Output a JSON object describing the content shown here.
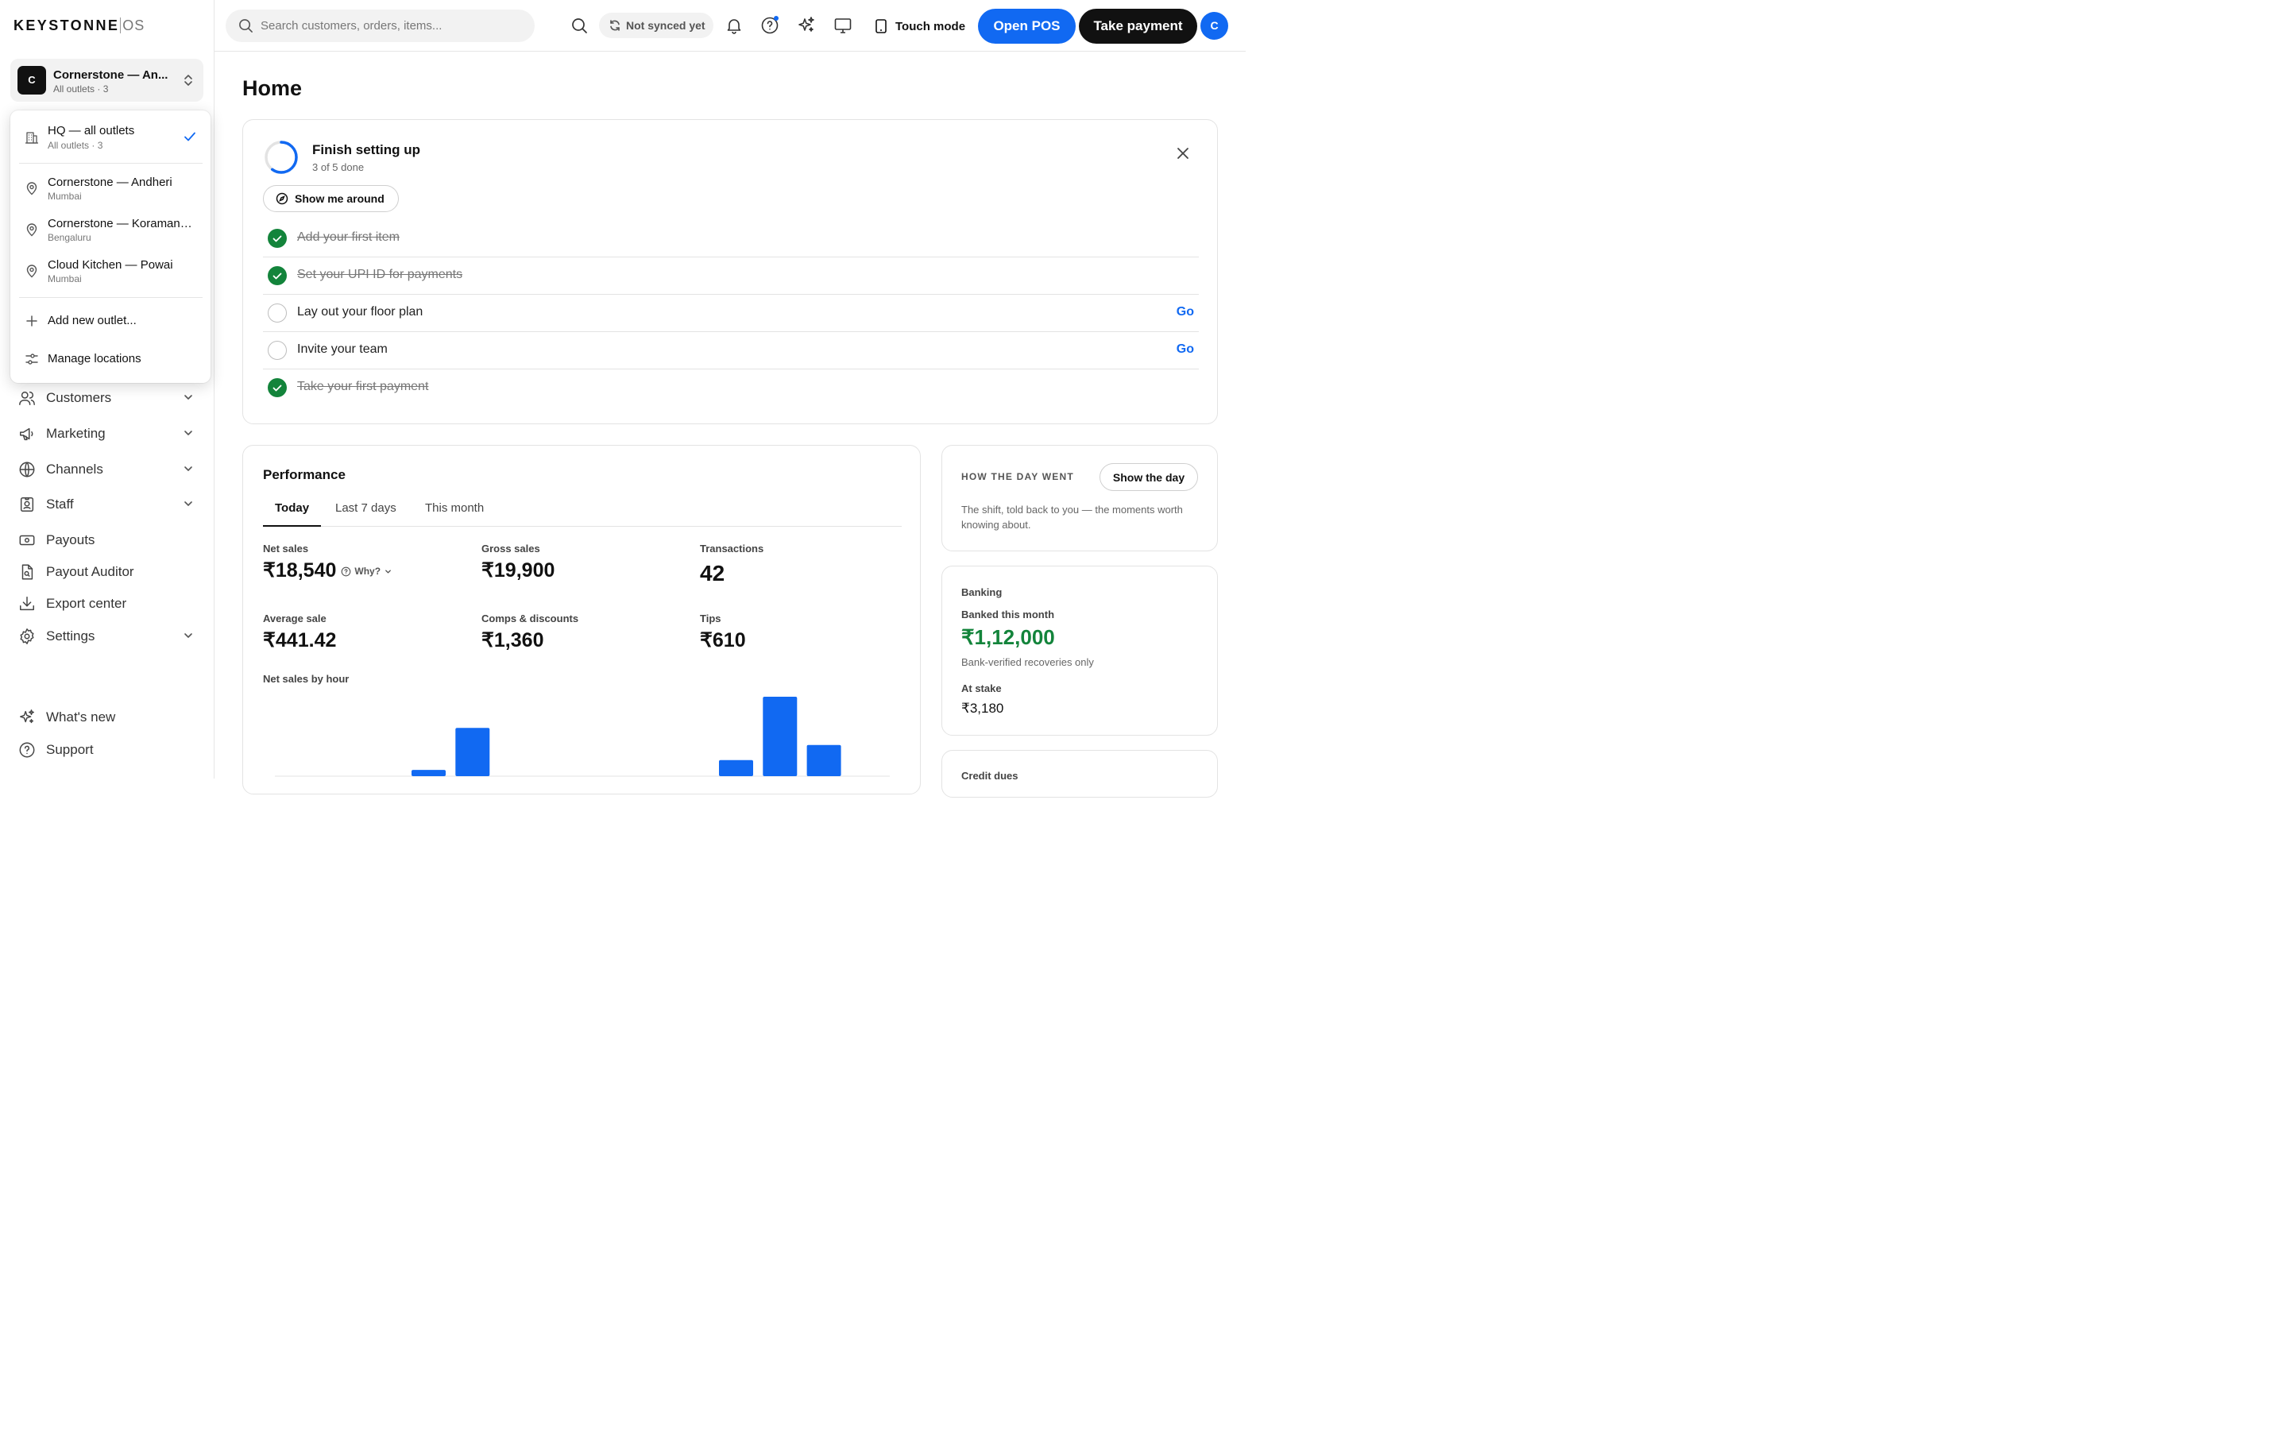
{
  "app": {
    "logo_main": "KEYSTONNE",
    "logo_suffix": "OS"
  },
  "org_switcher": {
    "avatar": "C",
    "name": "Cornerstone — An...",
    "sub": "All outlets · 3"
  },
  "outlet_menu": {
    "items": [
      {
        "title": "HQ — all outlets",
        "sub": "All outlets · 3",
        "selected": true,
        "icon": "building-icon"
      },
      {
        "title": "Cornerstone — Andheri",
        "sub": "Mumbai",
        "icon": "map-pin-icon"
      },
      {
        "title": "Cornerstone — Koramangala",
        "sub": "Bengaluru",
        "icon": "map-pin-icon"
      },
      {
        "title": "Cloud Kitchen — Powai",
        "sub": "Mumbai",
        "icon": "map-pin-icon"
      }
    ],
    "add_label": "Add new outlet...",
    "manage_label": "Manage locations"
  },
  "sidebar": {
    "items": [
      {
        "label": "Customers",
        "icon": "users-icon",
        "expandable": true
      },
      {
        "label": "Marketing",
        "icon": "megaphone-icon",
        "expandable": true
      },
      {
        "label": "Channels",
        "icon": "globe-icon",
        "expandable": true
      },
      {
        "label": "Staff",
        "icon": "id-badge-icon",
        "expandable": true
      },
      {
        "label": "Payouts",
        "icon": "banknote-icon",
        "expandable": false
      },
      {
        "label": "Payout Auditor",
        "icon": "file-search-icon",
        "expandable": false
      },
      {
        "label": "Export center",
        "icon": "download-icon",
        "expandable": false
      },
      {
        "label": "Settings",
        "icon": "gear-icon",
        "expandable": true
      }
    ],
    "footer": [
      {
        "label": "What's new",
        "icon": "sparkles-icon"
      },
      {
        "label": "Support",
        "icon": "help-circle-icon"
      }
    ]
  },
  "topbar": {
    "search_placeholder": "Search customers, orders, items...",
    "sync_status": "Not synced yet",
    "touch_mode": "Touch mode",
    "open_pos": "Open POS",
    "take_payment": "Take payment",
    "avatar": "C"
  },
  "page": {
    "title": "Home"
  },
  "setup": {
    "title": "Finish setting up",
    "progress_text": "3 of 5 done",
    "progress": 0.6,
    "show_around": "Show me around",
    "tasks": [
      {
        "label": "Add your first item",
        "done": true
      },
      {
        "label": "Set your UPI ID for payments",
        "done": true
      },
      {
        "label": "Lay out your floor plan",
        "done": false,
        "action": "Go"
      },
      {
        "label": "Invite your team",
        "done": false,
        "action": "Go"
      },
      {
        "label": "Take your first payment",
        "done": true
      }
    ]
  },
  "performance": {
    "title": "Performance",
    "tabs": [
      "Today",
      "Last 7 days",
      "This month"
    ],
    "active_tab": "Today",
    "metrics": {
      "net_sales_label": "Net sales",
      "net_sales": "₹18,540",
      "why_label": "Why?",
      "gross_sales_label": "Gross sales",
      "gross_sales": "₹19,900",
      "transactions_label": "Transactions",
      "transactions": "42",
      "avg_sale_label": "Average sale",
      "avg_sale": "₹441.42",
      "comps_label": "Comps & discounts",
      "comps": "₹1,360",
      "tips_label": "Tips",
      "tips": "₹610"
    },
    "chart_title": "Net sales by hour",
    "accent": "#1169f2"
  },
  "chart_data": {
    "type": "bar",
    "title": "Net sales by hour",
    "values": [
      0,
      0,
      0,
      7,
      54,
      0,
      0,
      0,
      0,
      0,
      18,
      89,
      35,
      0
    ],
    "note": "Axis ticks and hour labels are not visible in the screenshot; values are relative bar heights"
  },
  "day_summary": {
    "eyebrow": "HOW THE DAY WENT",
    "button": "Show the day",
    "description": "The shift, told back to you — the moments worth knowing about."
  },
  "banking": {
    "heading": "Banking",
    "banked_label": "Banked this month",
    "banked_value": "₹1,12,000",
    "note": "Bank-verified recoveries only",
    "stake_label": "At stake",
    "stake_value": "₹3,180"
  },
  "credit": {
    "heading": "Credit dues"
  }
}
